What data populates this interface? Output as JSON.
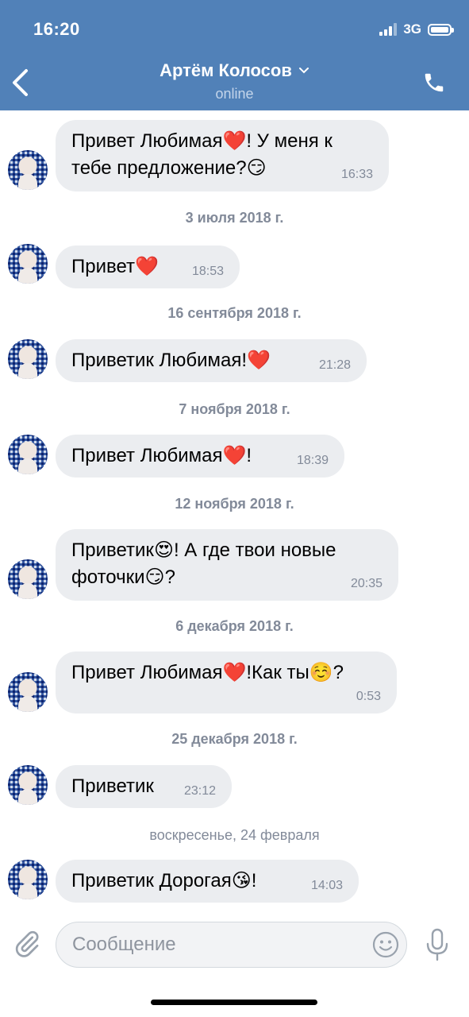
{
  "status_bar": {
    "time": "16:20",
    "network": "3G"
  },
  "header": {
    "contact_name": "Артём Колосов",
    "contact_status": "online"
  },
  "messages": [
    {
      "line1": "Привет Любимая",
      "emoji1": "❤️",
      "line1_after": "! У меня к",
      "line2": "тебе предложение?",
      "emoji2": "😏",
      "time": "16:33"
    },
    {
      "date": "3 июля 2018 г."
    },
    {
      "line1": "Привет",
      "emoji1": "❤️",
      "time": "18:53"
    },
    {
      "date": "16 сентября 2018 г."
    },
    {
      "line1": "Приветик Любимая!",
      "emoji1": "❤️",
      "time": "21:28"
    },
    {
      "date": "7 ноября 2018 г."
    },
    {
      "line1": "Привет Любимая",
      "emoji1": "❤️",
      "line1_after": "!",
      "time": "18:39"
    },
    {
      "date": "12 ноября 2018 г."
    },
    {
      "line1": "Приветик",
      "emoji1": "😍",
      "line1_after": "! А где твои новые",
      "line2": "фоточки",
      "emoji2": "😏",
      "line2_after": "?",
      "time": "20:35"
    },
    {
      "date": "6 декабря 2018 г."
    },
    {
      "line1": "Привет Любимая",
      "emoji1": "❤️",
      "line1_after": "!Как ты",
      "emoji1b": "☺️",
      "line1_end": "?",
      "time": "0:53"
    },
    {
      "date": "25 декабря 2018 г."
    },
    {
      "line1": "Приветик",
      "time": "23:12"
    },
    {
      "date": "воскресенье, 24 февраля"
    },
    {
      "line1": "Приветик Дорогая",
      "emoji1": "😘",
      "line1_after": "!",
      "time": "14:03"
    }
  ],
  "composer": {
    "placeholder": "Сообщение"
  },
  "icons": {
    "back": "chevron-left-icon",
    "call": "phone-icon",
    "attach": "paperclip-icon",
    "emoji": "smiley-icon",
    "mic": "microphone-icon"
  },
  "colors": {
    "header": "#5181b8",
    "bubble": "#ebedf0",
    "meta": "#828a99"
  }
}
